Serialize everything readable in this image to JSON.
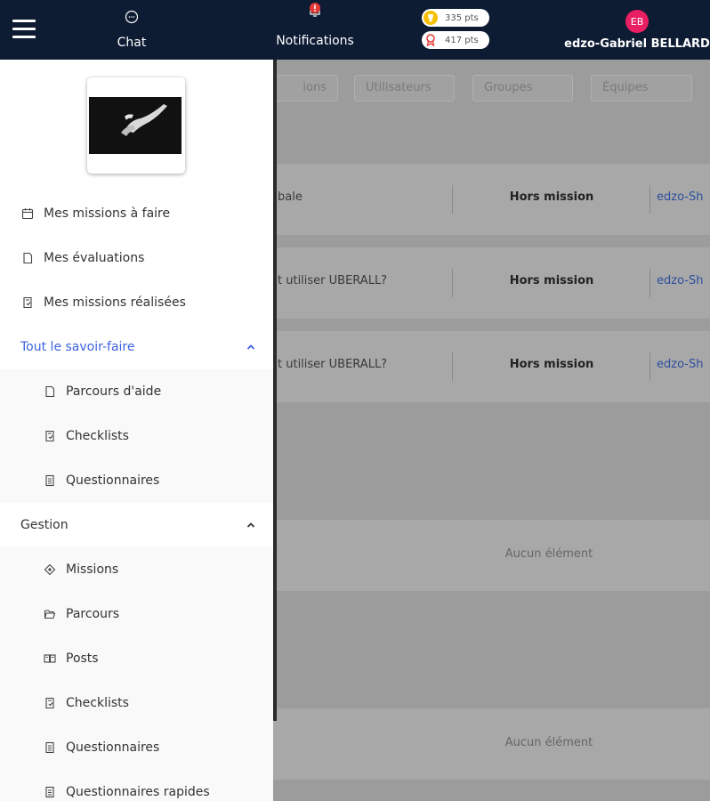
{
  "header": {
    "chat_label": "Chat",
    "notifications_label": "Notifications",
    "points": [
      {
        "value": "335 pts",
        "icon": "trophy-icon",
        "color": "#f5c000"
      },
      {
        "value": "417 pts",
        "icon": "award-icon",
        "color": "#e53935"
      }
    ],
    "user": {
      "initials": "EB",
      "name": "edzo-Gabriel BELLARD"
    }
  },
  "filters": {
    "tab1": "ions",
    "tab2": "Utilisateurs",
    "tab3": "Groupes",
    "tab4": "Équipes"
  },
  "rows": [
    {
      "title": "bale",
      "status": "Hors mission",
      "author": "edzo-Sh"
    },
    {
      "title": "t utiliser UBERALL?",
      "status": "Hors mission",
      "author": "edzo-Sh"
    },
    {
      "title": "t utiliser UBERALL?",
      "status": "Hors mission",
      "author": "edzo-Sh"
    }
  ],
  "empty_sections": [
    "Aucun élément",
    "Aucun élément"
  ],
  "sidebar": {
    "items": [
      {
        "label": "Mes missions à faire",
        "icon": "calendar-icon"
      },
      {
        "label": "Mes évaluations",
        "icon": "document-icon"
      },
      {
        "label": "Mes missions réalisées",
        "icon": "checklist-doc-icon"
      }
    ],
    "savoir_faire": {
      "label": "Tout le savoir-faire",
      "items": [
        {
          "label": "Parcours d'aide",
          "icon": "document-icon"
        },
        {
          "label": "Checklists",
          "icon": "checklist-doc-icon"
        },
        {
          "label": "Questionnaires",
          "icon": "questionnaire-icon"
        }
      ]
    },
    "gestion": {
      "label": "Gestion",
      "items": [
        {
          "label": "Missions",
          "icon": "target-icon"
        },
        {
          "label": "Parcours",
          "icon": "folder-open-icon"
        },
        {
          "label": "Posts",
          "icon": "book-open-icon"
        },
        {
          "label": "Checklists",
          "icon": "checklist-doc-icon"
        },
        {
          "label": "Questionnaires",
          "icon": "questionnaire-icon"
        },
        {
          "label": "Questionnaires rapides",
          "icon": "questionnaire-icon"
        }
      ]
    }
  },
  "colors": {
    "topbar": "#0d1b33",
    "accent": "#3d62e0",
    "avatar": "#e91e63",
    "link": "#2c4f9e"
  }
}
